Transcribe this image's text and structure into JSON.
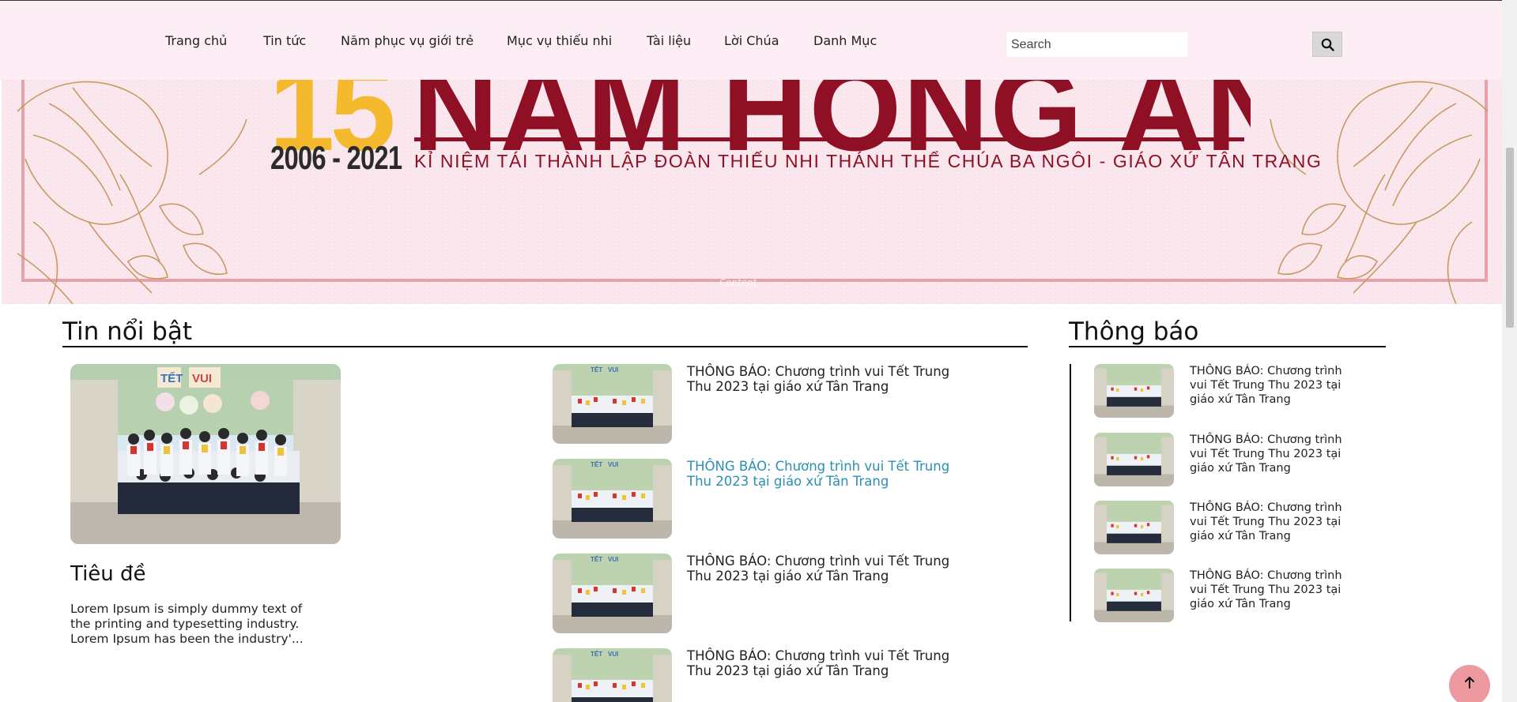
{
  "nav": {
    "items": [
      {
        "label": "Trang chủ"
      },
      {
        "label": "Tin tức"
      },
      {
        "label": "Năm phục vụ giới trẻ"
      },
      {
        "label": "Mục vụ thiếu nhi"
      },
      {
        "label": "Tài liệu"
      },
      {
        "label": "Lời Chúa"
      },
      {
        "label": "Danh Mục"
      }
    ],
    "search_placeholder": "Search",
    "search_icon": "search-icon"
  },
  "banner": {
    "number": "15",
    "title": "NĂM HỒNG ÂN",
    "years": "2006 - 2021",
    "subtitle": "KỈ NIỆM TÁI THÀNH LẬP ĐOÀN THIẾU NHI THÁNH THỂ CHÚA BA NGÔI - GIÁO XỨ TÂN TRANG",
    "faint_caption": "Content"
  },
  "featured": {
    "heading": "Tin nổi bật",
    "title": "Tiêu đề",
    "excerpt": "Lorem Ipsum is simply dummy text of the printing and typesetting industry. Lorem Ipsum has been the industry'..."
  },
  "news": [
    {
      "title": "THÔNG BÁO: Chương trình vui Tết Trung Thu 2023 tại giáo xứ Tân Trang"
    },
    {
      "title": "THÔNG BÁO: Chương trình vui Tết Trung Thu 2023 tại giáo xứ Tân Trang"
    },
    {
      "title": "THÔNG BÁO: Chương trình vui Tết Trung Thu 2023 tại giáo xứ Tân Trang"
    },
    {
      "title": "THÔNG BÁO: Chương trình vui Tết Trung Thu 2023 tại giáo xứ Tân Trang"
    }
  ],
  "notices": {
    "heading": "Thông báo",
    "items": [
      {
        "title": "THÔNG BÁO: Chương trình vui Tết Trung Thu 2023 tại giáo xứ Tân Trang"
      },
      {
        "title": "THÔNG BÁO: Chương trình vui Tết Trung Thu 2023 tại giáo xứ Tân Trang"
      },
      {
        "title": "THÔNG BÁO: Chương trình vui Tết Trung Thu 2023 tại giáo xứ Tân Trang"
      },
      {
        "title": "THÔNG BÁO: Chương trình vui Tết Trung Thu 2023 tại giáo xứ Tân Trang"
      }
    ]
  },
  "colors": {
    "nav_bg": "#fdeef6",
    "banner_red": "#8f1024",
    "banner_gold": "#f5b92e",
    "link_active": "#2b8fb1",
    "back_to_top": "#ec9aa0"
  },
  "back_to_top_icon": "arrow-up-icon"
}
